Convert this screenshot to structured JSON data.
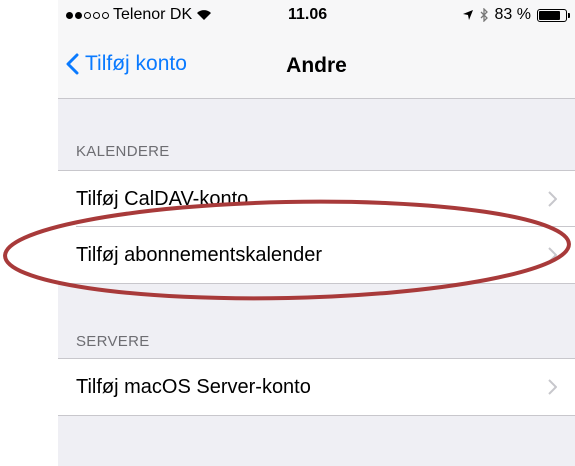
{
  "status_bar": {
    "carrier": "Telenor DK",
    "time": "11.06",
    "battery": "83 %",
    "battery_level": 0.83,
    "icons": [
      "signal-dots-icon",
      "wifi-icon",
      "location-arrow-icon",
      "bluetooth-icon",
      "battery-icon"
    ]
  },
  "nav": {
    "back_label": "Tilføj konto",
    "title": "Andre"
  },
  "sections": [
    {
      "header": "KALENDERE",
      "items": [
        {
          "label": "Tilføj CalDAV-konto"
        },
        {
          "label": "Tilføj abonnementskalender"
        }
      ]
    },
    {
      "header": "SERVERE",
      "items": [
        {
          "label": "Tilføj macOS Server-konto"
        }
      ]
    }
  ],
  "annotation": {
    "shape": "ellipse",
    "color": "#a83a3a",
    "highlights": "Tilføj abonnementskalender"
  },
  "colors": {
    "accent": "#0a7aff",
    "background": "#efeff4"
  }
}
